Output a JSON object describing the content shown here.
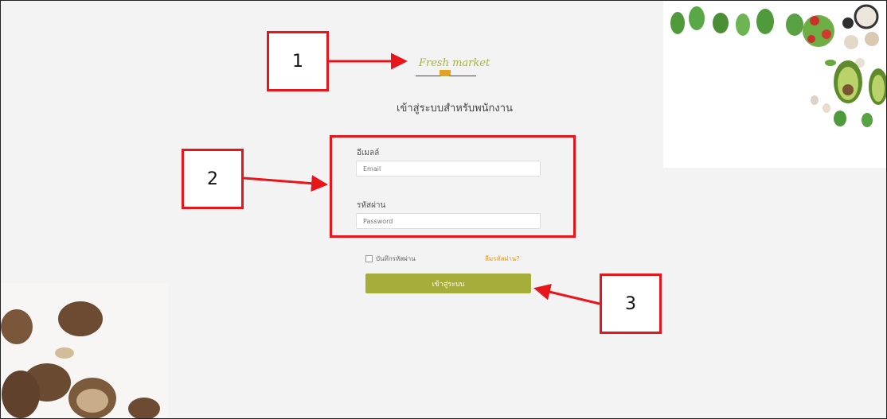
{
  "brand": {
    "logo_text": "Fresh market"
  },
  "login": {
    "title": "เข้าสู่ระบบสำหรับพนักงาน",
    "email_label": "อีเมลล์",
    "email_placeholder": "Email",
    "password_label": "รหัสผ่าน",
    "password_placeholder": "Password",
    "remember_label": "บันทึกรหัสผ่าน",
    "forgot_label": "ลืมรหัสผ่าน?",
    "submit_label": "เข้าสู่ระบบ"
  },
  "callouts": [
    "1",
    "2",
    "3"
  ],
  "colors": {
    "accent": "#a7ad3a",
    "highlight": "#e8161b",
    "link": "#e09a10"
  }
}
